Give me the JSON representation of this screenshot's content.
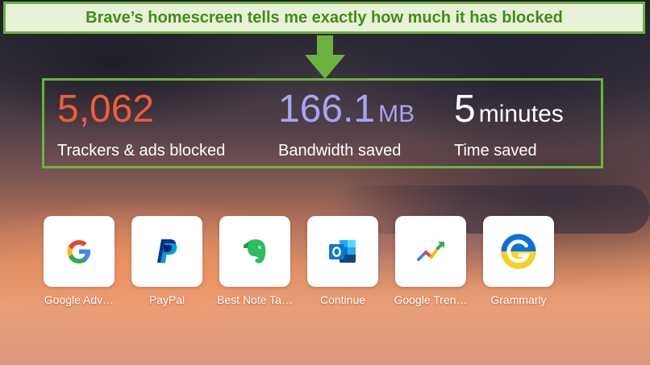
{
  "banner": {
    "text": "Brave’s homescreen tells me exactly how much it has blocked"
  },
  "stats": {
    "trackers": {
      "value": "5,062",
      "label": "Trackers & ads blocked"
    },
    "bandwidth": {
      "value": "166.1",
      "unit": "MB",
      "label": "Bandwidth saved"
    },
    "time": {
      "value": "5",
      "unit": "minutes",
      "label": "Time saved"
    }
  },
  "tiles": [
    {
      "label": "Google Adv…",
      "icon": "google-icon"
    },
    {
      "label": "PayPal",
      "icon": "paypal-icon"
    },
    {
      "label": "Best Note Ta…",
      "icon": "evernote-icon"
    },
    {
      "label": "Continue",
      "icon": "outlook-icon"
    },
    {
      "label": "Google Tren…",
      "icon": "google-trends-icon"
    },
    {
      "label": "Grammarly",
      "icon": "grammarly-icon"
    }
  ],
  "colors": {
    "annotation_green": "#6bb33e",
    "trackers_orange": "#f25b3a",
    "bandwidth_purple": "#a9a3f2"
  }
}
